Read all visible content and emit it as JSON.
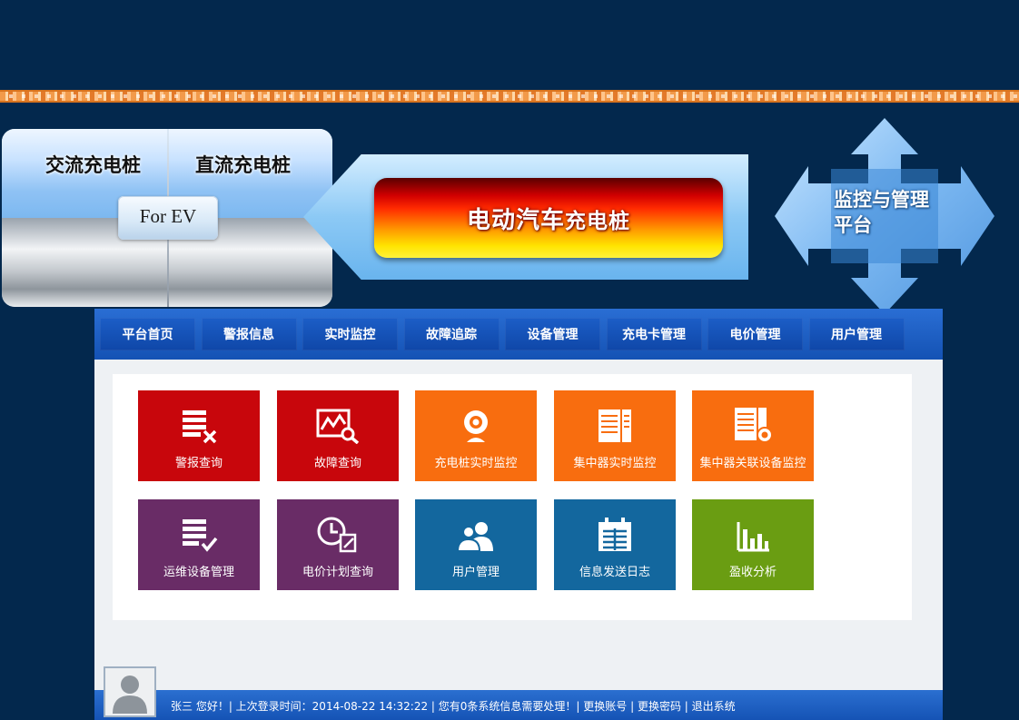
{
  "hero": {
    "ac_pile": "交流充电桩",
    "dc_pile": "直流充电桩",
    "for_ev": "For EV",
    "title_main": "电动汽车",
    "title_small": "充电桩",
    "platform_line1": "监控与管理",
    "platform_line2": "平台"
  },
  "nav": {
    "items": [
      "平台首页",
      "警报信息",
      "实时监控",
      "故障追踪",
      "设备管理",
      "充电卡管理",
      "电价管理",
      "用户管理"
    ]
  },
  "tiles": [
    {
      "label": "警报查询",
      "icon": "alarm-list-icon",
      "color": "#c8060c"
    },
    {
      "label": "故障查询",
      "icon": "fault-chart-search-icon",
      "color": "#c8060c"
    },
    {
      "label": "充电桩实时监控",
      "icon": "webcam-icon",
      "color": "#f86d0f"
    },
    {
      "label": "集中器实时监控",
      "icon": "server-rack-icon",
      "color": "#f86d0f"
    },
    {
      "label": "集中器关联设备监控",
      "icon": "server-linked-icon",
      "color": "#f86d0f"
    },
    {
      "label": "运维设备管理",
      "icon": "checklist-icon",
      "color": "#692c66"
    },
    {
      "label": "电价计划查询",
      "icon": "clock-edit-icon",
      "color": "#692c66"
    },
    {
      "label": "用户管理",
      "icon": "users-icon",
      "color": "#13679e"
    },
    {
      "label": "信息发送日志",
      "icon": "calendar-log-icon",
      "color": "#13679e"
    },
    {
      "label": "盈收分析",
      "icon": "bar-chart-icon",
      "color": "#6a9d12"
    }
  ],
  "footer": {
    "status": "张三 您好！| 上次登录时间：2014-08-22 14:32:22 | 您有0条系统信息需要处理！| 更换账号 | 更换密码 | 退出系统"
  }
}
